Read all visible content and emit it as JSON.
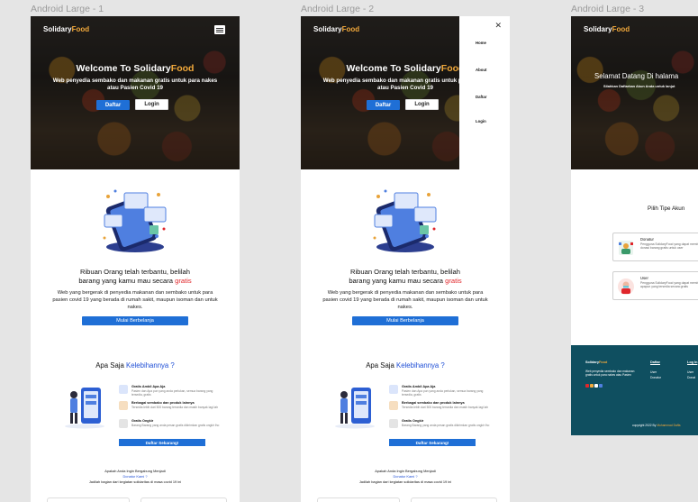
{
  "frames": [
    {
      "label": "Android Large - 1"
    },
    {
      "label": "Android Large - 2"
    },
    {
      "label": "Android Large - 3"
    }
  ],
  "brand": {
    "name_main": "Solidary",
    "name_accent": "Food",
    "accent_color": "#f2a93b",
    "primary_color": "#1f6fd6"
  },
  "hero": {
    "title_main": "Welcome To Solidary",
    "title_accent": "Food",
    "subtitle": "Web penyedia sembako dan makanan gratis untuk para nakes atau Pasien Covid 19",
    "daftar_label": "Daftar",
    "login_label": "Login"
  },
  "section1": {
    "title_line1": "Ribuan Orang telah terbantu, belilah",
    "title_line2_main": "barang yang kamu mau secara ",
    "title_line2_accent": "gratis",
    "description": "Web yang bergerak di penyedia makanan dan sembako untuk para pasien covid 19 yang berada di rumah sakit, maupun isoman dan untuk nakes.",
    "button_label": "Mulai Berbelanja"
  },
  "section2": {
    "title_main": "Apa Saja ",
    "title_accent": "Kelebihannya ?",
    "features": [
      {
        "title": "Gratis Ambil Apa Aja",
        "desc": "Pasien dan Apa pun yang anda perlukan, semua barang yang tersedia, gratis",
        "icon": "gift-icon"
      },
      {
        "title": "Berbagai sembako dan produk lainnya",
        "desc": "Tersedia lebih dari 500 barang tersedia dan masih banyak lagi lah",
        "icon": "grocery-icon"
      },
      {
        "title": "Gratis Ongkir",
        "desc": "Barang Barang yang anda pesan gratis dikirimkan gratis ongkir lho",
        "icon": "truck-icon"
      }
    ],
    "button_label": "Daftar Sekarang!"
  },
  "join": {
    "line1": "Apakah Anda Ingin Bergabung Menjadi",
    "line2": "Donatur Kami ?",
    "line3": "Jadilah bagian dari kegiatan solidaritas di masa covid 19 ini"
  },
  "menu": {
    "items": [
      "Home",
      "About",
      "Daftar",
      "Login"
    ],
    "close_icon": "close-icon"
  },
  "frame3": {
    "title": "Selamat Datang Di halama",
    "subtitle": "Silahkan Daftarkan Akun Anda untuk lanjut",
    "pilih": "Pilih Tipe Akun",
    "roles": [
      {
        "name": "Donatur",
        "desc": "Pengguna SolidaryFood yang dapat membantu donasi barang gratis untuk user"
      },
      {
        "name": "User",
        "desc": "Pengguna SolidaryFood yang dapat membeli barang apapun yang tersedia secara gratis"
      }
    ],
    "footer": {
      "desc": "Web penyedia sembako dan makanan gratis untuk para nakes atau Pasien",
      "col1_title": "Daftar",
      "col1_links": [
        "User",
        "Donatur"
      ],
      "col2_title": "Log In",
      "col2_links": [
        "User",
        "Donat"
      ],
      "copyright_main": "copyright 2022 By ",
      "copyright_accent": "Muhammad Daffa"
    }
  }
}
